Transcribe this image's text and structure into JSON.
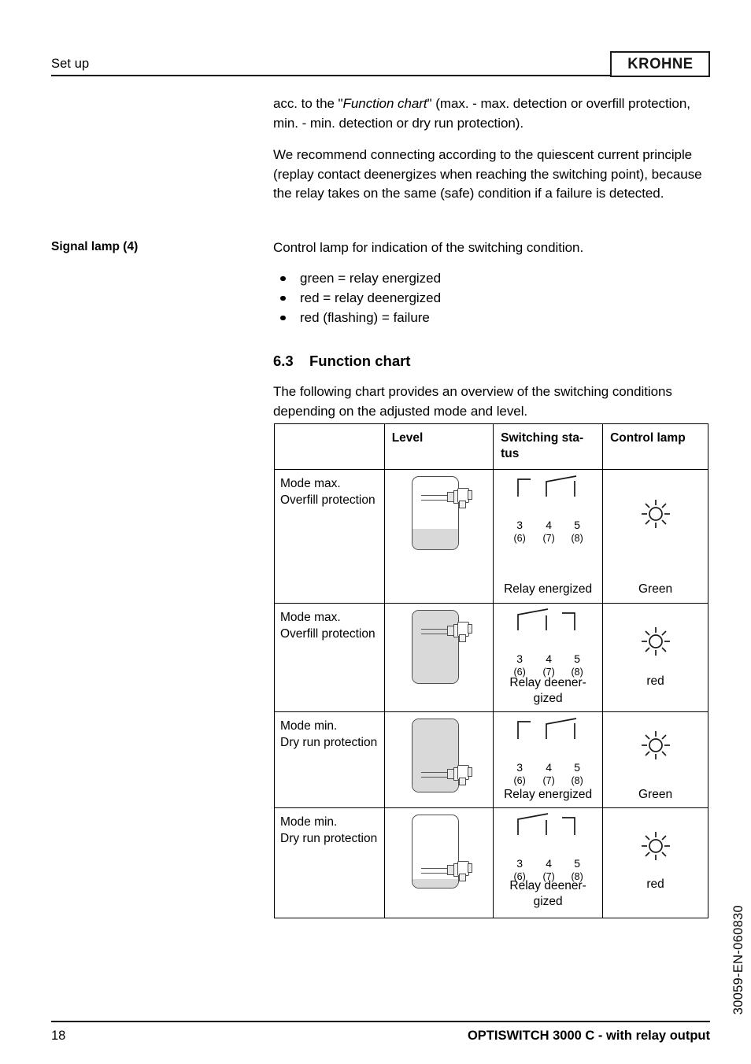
{
  "header": {
    "section_label": "Set up",
    "brand": "KROHNE"
  },
  "margin_notes": {
    "signal_lamp": "Signal lamp (4)"
  },
  "body": {
    "para_acc_pre": "acc. to the \"",
    "para_acc_italic": "Function chart",
    "para_acc_post": "\" (max. - max. detection or overfill protection, min. - min. detection or dry run protection).",
    "para_recommend": "We recommend connecting according to the quiescent current principle (replay contact deenergizes when reaching the switching point), because the relay takes on the same (safe) condition if a failure is detected.",
    "para_control_lamp": "Control lamp for indication of the switching condition.",
    "lamp_states": [
      "green = relay energized",
      "red = relay deenergized",
      "red (flashing) = failure"
    ],
    "section_number": "6.3",
    "section_title": "Function chart",
    "para_intro": "The following chart provides an overview of the switching conditions depending on the adjusted mode and level."
  },
  "chart_data": {
    "type": "table",
    "title": "Function chart",
    "columns": [
      "",
      "Level",
      "Switching status",
      "Control lamp"
    ],
    "rows": [
      {
        "mode_line1": "Mode max.",
        "mode_line2": "Overfill protection",
        "level_fill_percent": 28,
        "probe_position": "top",
        "switch_state": "energized",
        "switch_closed_terminals": "4-5",
        "terminals": [
          "3",
          "4",
          "5"
        ],
        "terminals_alt": [
          "(6)",
          "(7)",
          "(8)"
        ],
        "status_text": "Relay energized",
        "lamp_text": "Green"
      },
      {
        "mode_line1": "Mode max.",
        "mode_line2": "Overfill protection",
        "level_fill_percent": 100,
        "probe_position": "top",
        "switch_state": "deenergized",
        "switch_closed_terminals": "3-4",
        "terminals": [
          "3",
          "4",
          "5"
        ],
        "terminals_alt": [
          "(6)",
          "(7)",
          "(8)"
        ],
        "status_text": "Relay deener-gized",
        "lamp_text": "red"
      },
      {
        "mode_line1": "Mode min.",
        "mode_line2": "Dry run protection",
        "level_fill_percent": 100,
        "probe_position": "bottom",
        "switch_state": "energized",
        "switch_closed_terminals": "4-5",
        "terminals": [
          "3",
          "4",
          "5"
        ],
        "terminals_alt": [
          "(6)",
          "(7)",
          "(8)"
        ],
        "status_text": "Relay energized",
        "lamp_text": "Green"
      },
      {
        "mode_line1": "Mode min.",
        "mode_line2": "Dry run protection",
        "level_fill_percent": 12,
        "probe_position": "bottom",
        "switch_state": "deenergized",
        "switch_closed_terminals": "3-4",
        "terminals": [
          "3",
          "4",
          "5"
        ],
        "terminals_alt": [
          "(6)",
          "(7)",
          "(8)"
        ],
        "status_text": "Relay deener-gized",
        "lamp_text": "red"
      }
    ],
    "colors": {
      "liquid": "#d9d9d9",
      "outline": "#4d4d4d",
      "line": "#000000"
    }
  },
  "footer": {
    "page_number": "18",
    "document_title": "OPTISWITCH 3000 C - with relay output",
    "doc_code": "30059-EN-060830"
  }
}
